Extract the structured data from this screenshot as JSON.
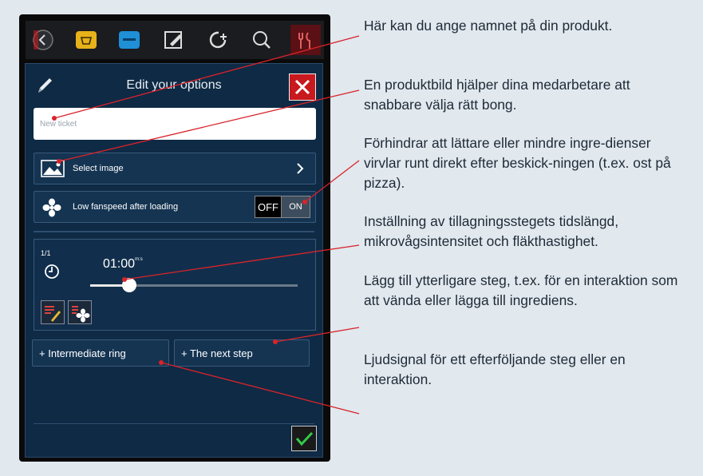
{
  "panel": {
    "title": "Edit your options",
    "ticket_placeholder": "New ticket",
    "select_image_label": "Select image",
    "fanspeed_label": "Low fanspeed after loading",
    "toggle_off": "OFF",
    "toggle_on": "ON",
    "step_counter": "1/1",
    "timer_value": "01:00",
    "timer_unit": "m:s",
    "slider_value": 0.19,
    "intermediate_ring_label": "+ Intermediate ring",
    "next_step_label": "+ The next step"
  },
  "annotations": [
    "Här kan du ange namnet på din produkt.",
    "En produktbild hjälper dina medarbetare att snabbare välja rätt bong.",
    "Förhindrar att lättare eller mindre ingre-dienser virvlar runt direkt efter beskick-ningen (t.ex. ost på pizza).",
    "Inställning av tillagningsstegets tidslängd, mikrovågsintensitet och fläkthastighet.",
    "Lägg till ytterligare steg, t.ex. för en interaktion som att vända eller lägga till ingrediens.",
    "Ljudsignal för ett efterföljande steg eller en interaktion."
  ],
  "colors": {
    "background": "#e1e8ee",
    "panel": "#0e2a45",
    "callout_line": "#d9232a",
    "close_button": "#c8191e",
    "confirm_check": "#35c94b"
  }
}
